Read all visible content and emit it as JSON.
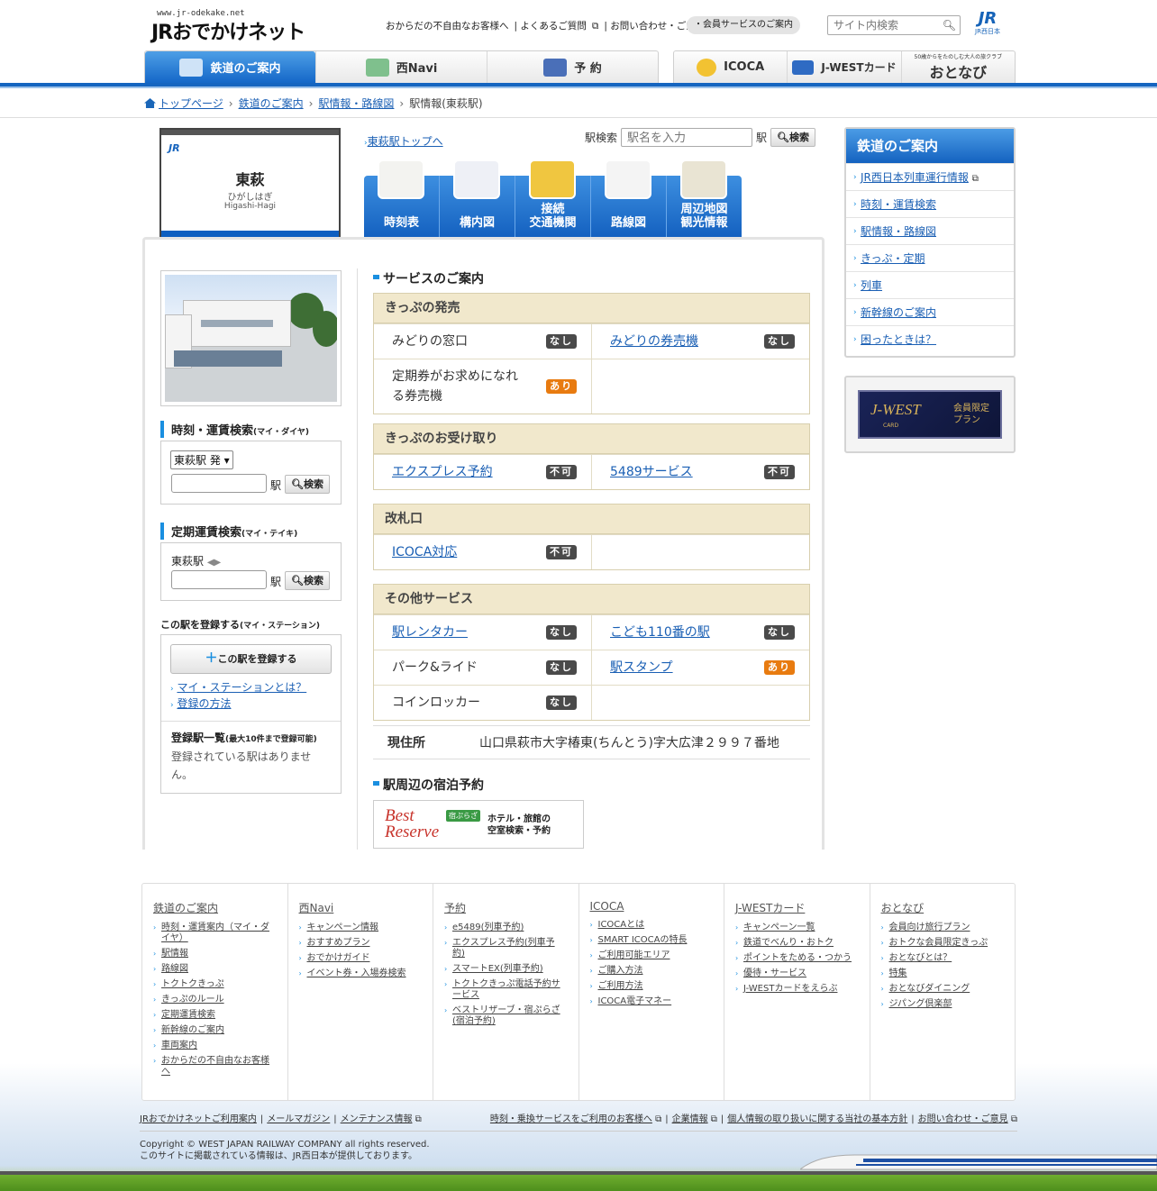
{
  "header": {
    "logo_url": "www.jr-odekake.net",
    "logo": "JRおでかけネット",
    "util_links": [
      "おからだの不自由なお客様へ",
      "よくあるご質問",
      "お問い合わせ・ご意見"
    ],
    "member_button": "・会員サービスのご案内",
    "site_search_placeholder": "サイト内検索",
    "jr_west_mark": "JR",
    "jr_west_text": "JR西日本"
  },
  "global_nav": {
    "left": [
      {
        "label": "鉄道のご案内",
        "active": true
      },
      {
        "label": "西Navi",
        "active": false
      },
      {
        "label": "予 約",
        "active": false
      }
    ],
    "right": [
      {
        "label": "ICOCA"
      },
      {
        "label": "J-WESTカード"
      },
      {
        "label": "おとなび",
        "sub": "50歳からをたのしむ大人の旅クラブ"
      }
    ]
  },
  "breadcrumb": [
    "トップページ",
    "鉄道のご案内",
    "駅情報・路線図",
    "駅情報(東萩駅)"
  ],
  "station": {
    "jr": "JR",
    "name": "東萩",
    "kana": "ひがしはぎ",
    "romaji": "Higashi-Hagi",
    "top_link": "東萩駅トップへ",
    "search_label": "駅検索",
    "search_placeholder": "駅名を入力",
    "search_suffix": "駅",
    "search_button": "検索"
  },
  "station_tabs": [
    {
      "label": "時刻表",
      "icon": "timetable-icon"
    },
    {
      "label": "構内図",
      "icon": "floor-map-icon"
    },
    {
      "label": "接続\n交通機関",
      "icon": "bus-icon"
    },
    {
      "label": "路線図",
      "icon": "route-map-icon"
    },
    {
      "label": "周辺地図\n観光情報",
      "icon": "area-map-icon"
    }
  ],
  "sidebar": {
    "fare_search": {
      "title": "時刻・運賃検索",
      "title_small": "(マイ・ダイヤ)",
      "select_value": "東萩駅 発",
      "suffix": "駅",
      "button": "検索"
    },
    "pass_search": {
      "title": "定期運賃検索",
      "title_small": "(マイ・テイキ)",
      "from": "東萩駅",
      "suffix": "駅",
      "button": "検索"
    },
    "register": {
      "title": "この駅を登録する",
      "title_small": "(マイ・ステーション)",
      "button": "この駅を登録する",
      "links": [
        "マイ・ステーションとは？",
        "登録の方法"
      ],
      "list_title": "登録駅一覧",
      "list_small": "(最大10件まで登録可能)",
      "list_empty": "登録されている駅はありません。"
    }
  },
  "services": {
    "title": "サービスのご案内",
    "groups": [
      {
        "title": "きっぷの発売",
        "rows": [
          [
            {
              "name": "みどりの窓口",
              "link": false,
              "status": "なし"
            },
            {
              "name": "みどりの券売機",
              "link": true,
              "status": "なし"
            }
          ],
          [
            {
              "name": "定期券がお求めになれる券売機",
              "link": false,
              "status": "あり"
            },
            null
          ]
        ]
      },
      {
        "title": "きっぷのお受け取り",
        "rows": [
          [
            {
              "name": "エクスプレス予約",
              "link": true,
              "status": "不可"
            },
            {
              "name": "5489サービス",
              "link": true,
              "status": "不可"
            }
          ]
        ]
      },
      {
        "title": "改札口",
        "rows": [
          [
            {
              "name": "ICOCA対応",
              "link": true,
              "status": "不可"
            },
            null
          ]
        ]
      },
      {
        "title": "その他サービス",
        "rows": [
          [
            {
              "name": "駅レンタカー",
              "link": true,
              "status": "なし"
            },
            {
              "name": "こども110番の駅",
              "link": true,
              "status": "なし"
            }
          ],
          [
            {
              "name": "パーク&ライド",
              "link": false,
              "status": "なし"
            },
            {
              "name": "駅スタンプ",
              "link": true,
              "status": "あり"
            }
          ],
          [
            {
              "name": "コインロッカー",
              "link": false,
              "status": "なし"
            },
            null
          ]
        ]
      }
    ],
    "address_label": "現住所",
    "address": "山口県萩市大字椿東(ちんとう)字大広津２９９７番地",
    "hotel_title": "駅周辺の宿泊予約",
    "best_reserve": {
      "line1": "Best",
      "line2": "Reserve",
      "tag": "宿ぷらざ",
      "text": "ホテル・旅館の\n空室検索・予約"
    }
  },
  "right_menu": {
    "title": "鉄道のご案内",
    "items": [
      "JR西日本列車運行情報",
      "時刻・運賃検索",
      "駅情報・路線図",
      "きっぷ・定期",
      "列車",
      "新幹線のご案内",
      "困ったときは？"
    ]
  },
  "jwest_banner": {
    "logo": "J-WEST",
    "card": "CARD",
    "text": "会員限定\nプラン"
  },
  "footer": {
    "columns": [
      {
        "title": "鉄道のご案内",
        "items": [
          "時刻・運賃案内（マイ・ダイヤ）",
          "駅情報",
          "路線図",
          "トクトクきっぷ",
          "きっぷのルール",
          "定期運賃検索",
          "新幹線のご案内",
          "車両案内",
          "おからだの不自由なお客様へ"
        ]
      },
      {
        "title": "西Navi",
        "items": [
          "キャンペーン情報",
          "おすすめプラン",
          "おでかけガイド",
          "イベント券・入場券検索"
        ]
      },
      {
        "title": "予約",
        "items": [
          "e5489(列車予約)",
          "エクスプレス予約(列車予約)",
          "スマートEX(列車予約)",
          "トクトクきっぷ電話予約サービス",
          "ベストリザーブ・宿ぷらざ(宿泊予約)"
        ]
      },
      {
        "title": "ICOCA",
        "items": [
          "ICOCAとは",
          "SMART ICOCAの特長",
          "ご利用可能エリア",
          "ご購入方法",
          "ご利用方法",
          "ICOCA電子マネー"
        ]
      },
      {
        "title": "J-WESTカード",
        "items": [
          "キャンペーン一覧",
          "鉄道でべんり・おトク",
          "ポイントをためる・つかう",
          "優待・サービス",
          "J-WESTカードをえらぶ"
        ]
      },
      {
        "title": "おとなび",
        "items": [
          "会員向け旅行プラン",
          "おトクな会員限定きっぷ",
          "おとなびとは？",
          "特集",
          "おとなびダイニング",
          "ジパング倶楽部"
        ]
      }
    ],
    "bottom_left": [
      "JRおでかけネットご利用案内",
      "メールマガジン",
      "メンテナンス情報"
    ],
    "bottom_right": [
      "時刻・乗換サービスをご利用のお客様へ",
      "企業情報",
      "個人情報の取り扱いに関する当社の基本方針",
      "お問い合わせ・ご意見"
    ],
    "copyright": "Copyright © WEST JAPAN RAILWAY COMPANY all rights reserved.",
    "note": "このサイトに掲載されている情報は、JR西日本が提供しております。"
  }
}
